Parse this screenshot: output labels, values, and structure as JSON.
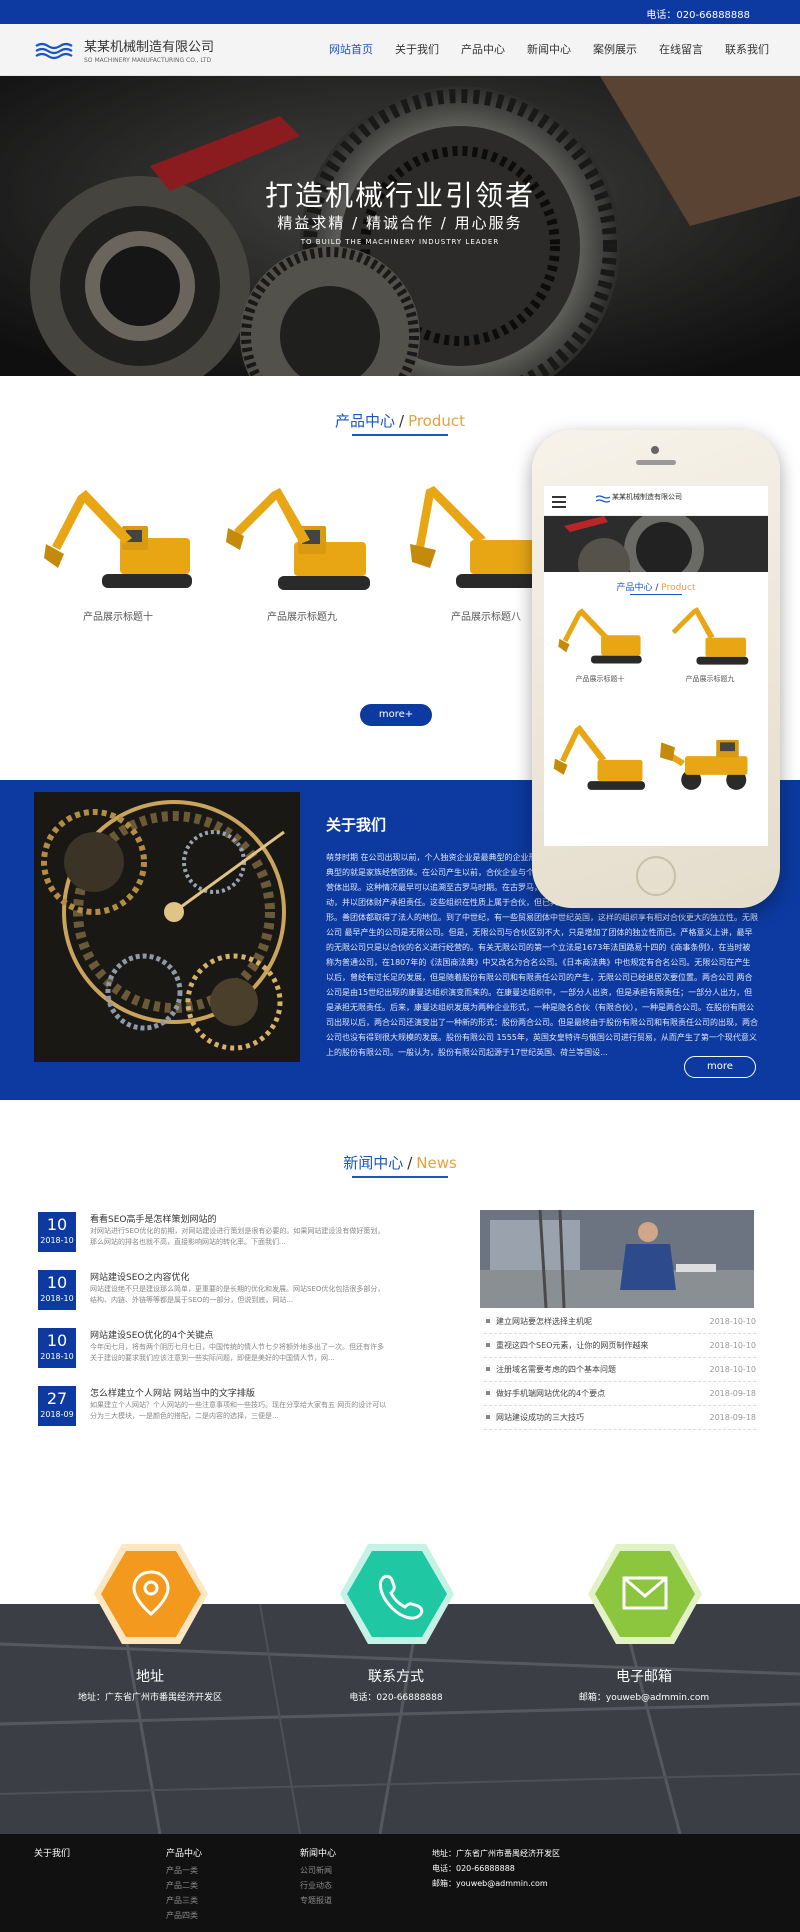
{
  "topbar": {
    "phone": "电话：020-66888888"
  },
  "header": {
    "logo_cn": "某某机械制造有限公司",
    "logo_en": "SO MACHINERY MANUFACTURING CO., LTD",
    "nav": [
      "网站首页",
      "关于我们",
      "产品中心",
      "新闻中心",
      "案例展示",
      "在线留言",
      "联系我们"
    ],
    "active_nav": "网站首页"
  },
  "banner": {
    "title": "打造机械行业引领者",
    "subtitle": "精益求精 / 精诚合作 / 用心服务",
    "en": "TO BUILD THE MACHINERY INDUSTRY LEADER"
  },
  "products": {
    "title_cn": "产品中心",
    "title_en": "Product",
    "items": [
      "产品展示标题十",
      "产品展示标题九",
      "产品展示标题八"
    ],
    "more": "more+"
  },
  "about": {
    "title": "关于我们",
    "text": "萌芽时期 在公司出现以前，个人独资企业是最典型的企业形式。在公司之前，合伙企业是最典型的企业组织形式。织中最典型的就是家族经营团体。在公司产生以前，合伙企业与个人独资企业是主要的企业组织形式，到了公元前3世纪，一些经营体出现。这种情况最早可以追溯至古罗马时期。在古罗马，就曾出现过由几个人组成的商业团体，以团体名义从事贸易活动，并以团体财产承担责任。这些组织在性质上属于合伙，但已具有公司的某些特征，这些团体被某些学者视为公司的雏形。善团体都取得了法人的地位。到了中世纪，有一些贸易团体中世纪英国，这样的组织享有相对合伙更大的独立性。无限公司 最早产生的公司是无限公司。但是，无限公司与合伙区别不大，只是增加了团体的独立性而已。严格意义上讲，最早的无限公司只是以合伙的名义进行经营的。有关无限公司的第一个立法是1673年法国路易十四的《商事条例》，在当时被称为普通公司，在1807年的《法国商法典》中又改名为合名公司。《日本商法典》中也规定有合名公司。无限公司在产生以后，曾经有过长足的发展，但是随着股份有限公司和有限责任公司的产生，无限公司已经退居次要位置。两合公司 两合公司是由15世纪出现的康曼达组织演变而来的。在康曼达组织中，一部分人出资，但是承担有限责任；一部分人出力，但是承担无限责任。后来，康曼达组织发展为两种企业形式，一种是隐名合伙（有限合伙），一种是两合公司。在股份有限公司出现以后，两合公司还演变出了一种新的形式：股份两合公司。但是最终由于股份有限公司和有限责任公司的出现，两合公司也没有得到很大规模的发展。股份有限公司 1555年，英国女皇特许与俄国公司进行贸易，从而产生了第一个现代意义上的股份有限公司。一般认为，股份有限公司起源于17世纪英国、荷兰等国设...",
    "more": "more"
  },
  "news": {
    "title_cn": "新闻中心",
    "title_en": "News",
    "items": [
      {
        "day": "10",
        "ym": "2018-10",
        "title": "看看SEO高手是怎样策划网站的",
        "desc": "对网站进行SEO优化的前期，对网站建设进行策划是很有必要的。如果网站建设没有做好策划，那么网站的排名也就不高，直接影响网站的转化率。下面我们..."
      },
      {
        "day": "10",
        "ym": "2018-10",
        "title": "网站建设SEO之内容优化",
        "desc": "网站建设绝不只是建设那么简单，更重要的是长期的优化和发展。网站SEO优化包括很多部分，结构、内链、外链等等都是属于SEO的一部分，但说到底，网站..."
      },
      {
        "day": "10",
        "ym": "2018-10",
        "title": "网站建设SEO优化的4个关键点",
        "desc": "今年闰七月，将有两个阴历七月七日，中国传统的情人节七夕将额外地多出了一次。但还有许多关于建设的要求我们应该注意到一些实际问题，即便是美好的中国情人节，网..."
      },
      {
        "day": "27",
        "ym": "2018-09",
        "title": "怎么样建立个人网站 网站当中的文字排版",
        "desc": "如果建立个人网站？个人网站的一些注意事项和一些技巧。现在分享给大家有五 网页的设计可以分为三大模块，一是颜色的搭配，二是内容的选择，三便是..."
      }
    ],
    "list": [
      {
        "title": "建立网站要怎样选择主机呢",
        "date": "2018-10-10"
      },
      {
        "title": "重视这四个SEO元素，让你的网页制作越来",
        "date": "2018-10-10"
      },
      {
        "title": "注册域名需要考虑的四个基本问题",
        "date": "2018-10-10"
      },
      {
        "title": "做好手机端网站优化的4个要点",
        "date": "2018-09-18"
      },
      {
        "title": "网站建设成功的三大技巧",
        "date": "2018-09-18"
      }
    ]
  },
  "contact": {
    "address_title": "地址",
    "address_value": "地址：广东省广州市番禺经济开发区",
    "phone_title": "联系方式",
    "phone_value": "电话：020-66888888",
    "email_title": "电子邮箱",
    "email_value": "邮箱：youweb@admmin.com",
    "colors": {
      "address": "#f39a1e",
      "phone": "#1fc7a3",
      "email": "#8cc63f"
    }
  },
  "footer": {
    "col1_head": "关于我们",
    "col2_head": "产品中心",
    "col2_links": [
      "产品一类",
      "产品二类",
      "产品三类",
      "产品四类"
    ],
    "col3_head": "新闻中心",
    "col3_links": [
      "公司新闻",
      "行业动态",
      "专题报道"
    ],
    "address": "地址：广东省广州市番禺经济开发区",
    "phone": "电话：020-66888888",
    "email": "邮箱：youweb@admmin.com"
  },
  "phone_mock": {
    "logo": "某某机械制造有限公司",
    "title_cn": "产品中心",
    "title_en": "Product",
    "items": [
      "产品展示标题十",
      "产品展示标题九"
    ]
  }
}
